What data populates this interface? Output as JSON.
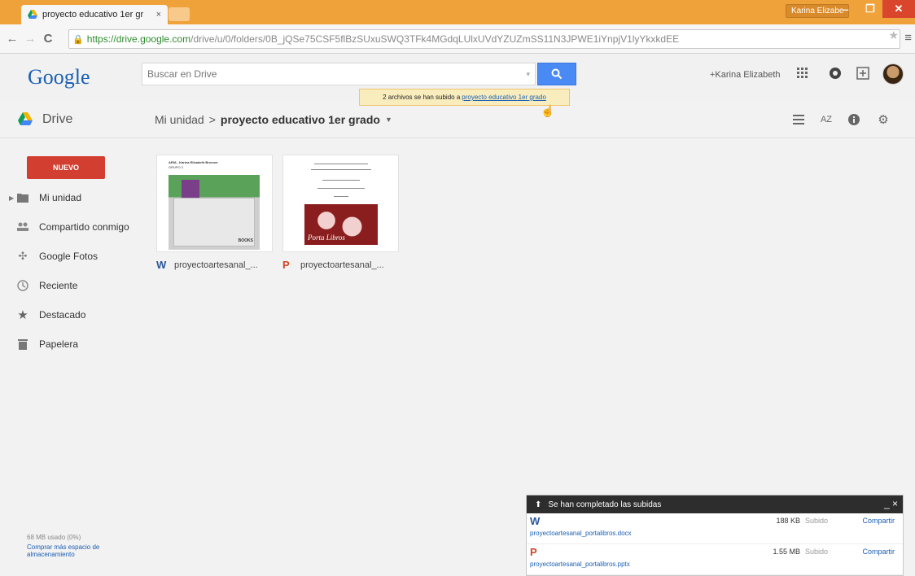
{
  "browser": {
    "tab_title": "proyecto educativo 1er gr",
    "tab_close": "×",
    "profile_name": "Karina Elizabe",
    "url_scheme_host": "https://drive.google.com",
    "url_path": "/drive/u/0/folders/0B_jQSe75CSF5flBzSUxuSWQ3TFk4MGdqLUlxUVdYZUZmSS11N3JPWE1iYnpjV1lyYkxkdEE"
  },
  "google_header": {
    "logo": "Google",
    "search_placeholder": "Buscar en Drive",
    "user_name": "+Karina Elizabeth"
  },
  "notification": {
    "text": "2 archivos se han subido a",
    "link": "proyecto educativo 1er grado"
  },
  "drive_bar": {
    "app_name": "Drive",
    "breadcrumb_root": "Mi unidad",
    "breadcrumb_sep": ">",
    "breadcrumb_current": "proyecto educativo 1er grado",
    "caret": "▼"
  },
  "sidebar": {
    "new_label": "NUEVO",
    "items": [
      {
        "label": "Mi unidad",
        "icon": "folder-icon"
      },
      {
        "label": "Compartido conmigo",
        "icon": "people-icon"
      },
      {
        "label": "Google Fotos",
        "icon": "pinwheel-icon"
      },
      {
        "label": "Reciente",
        "icon": "clock-icon"
      },
      {
        "label": "Destacado",
        "icon": "star-icon"
      },
      {
        "label": "Papelera",
        "icon": "trash-icon"
      }
    ],
    "storage_used": "68 MB usado (0%)",
    "buy_storage": "Comprar más espacio de almacenamiento"
  },
  "files": [
    {
      "name": "proyectoartesanal_...",
      "type": "W",
      "color": "#2b579a"
    },
    {
      "name": "proyectoartesanal_...",
      "type": "P",
      "color": "#d24726"
    }
  ],
  "thumbs": {
    "word_header": "ARIA - Karina Elizabeth Brenner",
    "word_sub": "GRUPO 2",
    "word_label": "BOOKS",
    "ppt_title": "Porta Libros"
  },
  "uploads": {
    "title": "Se han completado las subidas",
    "controls": "_ ×",
    "rows": [
      {
        "type": "W",
        "color": "#2b579a",
        "name": "proyectoartesanal_portalibros.docx",
        "size": "188 KB",
        "status": "Subido",
        "action": "Compartir"
      },
      {
        "type": "P",
        "color": "#d24726",
        "name": "proyectoartesanal_portalibros.pptx",
        "size": "1.55 MB",
        "status": "Subido",
        "action": "Compartir"
      }
    ]
  },
  "colors": {
    "chrome_accent": "#f0a23a",
    "new_button": "#d23f31",
    "search_button": "#4a8af4",
    "link": "#1a5fb4"
  }
}
